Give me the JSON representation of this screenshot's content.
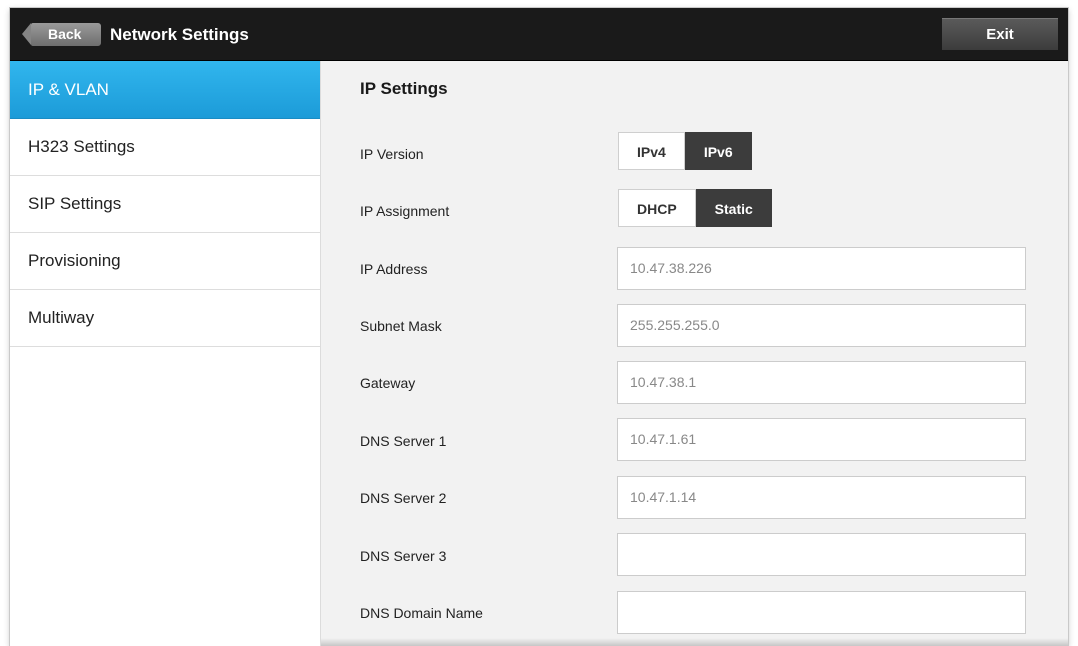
{
  "header": {
    "back_label": "Back",
    "title": "Network Settings",
    "exit_label": "Exit"
  },
  "sidebar": {
    "items": [
      {
        "label": "IP & VLAN",
        "active": true
      },
      {
        "label": "H323 Settings",
        "active": false
      },
      {
        "label": "SIP Settings",
        "active": false
      },
      {
        "label": "Provisioning",
        "active": false
      },
      {
        "label": "Multiway",
        "active": false
      }
    ]
  },
  "main": {
    "section_title": "IP Settings",
    "ip_version": {
      "label": "IP Version",
      "options": [
        "IPv4",
        "IPv6"
      ],
      "selected": "IPv6"
    },
    "ip_assignment": {
      "label": "IP Assignment",
      "options": [
        "DHCP",
        "Static"
      ],
      "selected": "Static"
    },
    "fields": [
      {
        "label": "IP Address",
        "value": "10.47.38.226"
      },
      {
        "label": "Subnet Mask",
        "value": "255.255.255.0"
      },
      {
        "label": "Gateway",
        "value": "10.47.38.1"
      },
      {
        "label": "DNS Server 1",
        "value": "10.47.1.61"
      },
      {
        "label": "DNS Server 2",
        "value": "10.47.1.14"
      },
      {
        "label": "DNS Server 3",
        "value": ""
      },
      {
        "label": "DNS Domain Name",
        "value": ""
      }
    ]
  },
  "colors": {
    "accent": "#1c9bd8",
    "topbar": "#1a1a1a",
    "selected_segment": "#3c3c3c"
  }
}
